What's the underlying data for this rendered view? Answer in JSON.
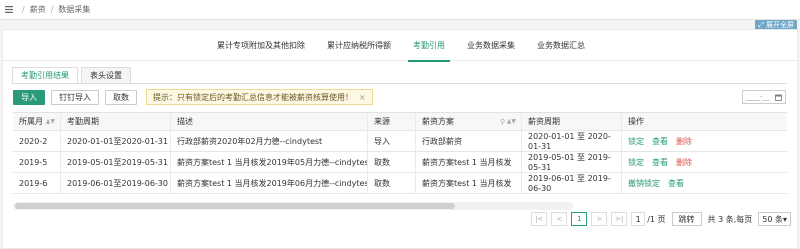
{
  "breadcrumb": {
    "items": [
      "薪资",
      "数据采集"
    ],
    "separator": "/"
  },
  "fullscreen_label": "展开全屏",
  "top_tabs": [
    {
      "label": "累计专项附加及其他扣除",
      "active": false
    },
    {
      "label": "累计应纳税所得额",
      "active": false
    },
    {
      "label": "考勤引用",
      "active": true
    },
    {
      "label": "业务数据采集",
      "active": false
    },
    {
      "label": "业务数据汇总",
      "active": false
    }
  ],
  "sub_tabs": [
    {
      "label": "考勤引用结果",
      "active": true
    },
    {
      "label": "表头设置",
      "active": false
    }
  ],
  "toolbar": {
    "import_label": "导入",
    "dingtalk_label": "钉钉导入",
    "fetch_label": "取数",
    "hint": "提示：只有锁定后的考勤汇总信息才能被薪资核算使用！",
    "hint_close": "×"
  },
  "date_field": {
    "placeholder": "____-__"
  },
  "table": {
    "headers": [
      "所属月",
      "考勤周期",
      "描述",
      "来源",
      "薪资方案",
      "薪资周期",
      "操作"
    ],
    "rows": [
      {
        "month": "2020-2",
        "cycle": "2020-01-01至2020-01-31",
        "desc": "行政部薪资2020年02月力德--cindytest",
        "source": "导入",
        "plan": "行政部薪资",
        "period": "2020-01-01 至 2020-01-31",
        "actions": [
          {
            "label": "锁定",
            "color": "green"
          },
          {
            "label": "查看",
            "color": "green"
          },
          {
            "label": "删除",
            "color": "red"
          }
        ]
      },
      {
        "month": "2019-5",
        "cycle": "2019-05-01至2019-05-31",
        "desc": "薪资方案test 1 当月核发2019年05月力德--cindytest",
        "source": "取数",
        "plan": "薪资方案test 1 当月核发",
        "period": "2019-05-01 至 2019-05-31",
        "actions": [
          {
            "label": "锁定",
            "color": "green"
          },
          {
            "label": "查看",
            "color": "green"
          },
          {
            "label": "删除",
            "color": "red"
          }
        ]
      },
      {
        "month": "2019-6",
        "cycle": "2019-06-01至2019-06-30",
        "desc": "薪资方案test 1 当月核发2019年06月力德--cindytest",
        "source": "取数",
        "plan": "薪资方案test 1 当月核发",
        "period": "2019-06-01 至 2019-06-30",
        "actions": [
          {
            "label": "撤销锁定",
            "color": "green"
          },
          {
            "label": "查看",
            "color": "green"
          }
        ]
      }
    ]
  },
  "pager": {
    "first": "|<",
    "prev": "<",
    "current": "1",
    "next": ">",
    "last": ">|",
    "page_input": "1",
    "total_pages": "/1 页",
    "go_label": "跳转",
    "summary": "共 3 条,每页",
    "page_size": "50 条▾"
  },
  "colors": {
    "accent": "#239976",
    "danger": "#d9534f",
    "hint_bg": "#fdf8e4"
  }
}
